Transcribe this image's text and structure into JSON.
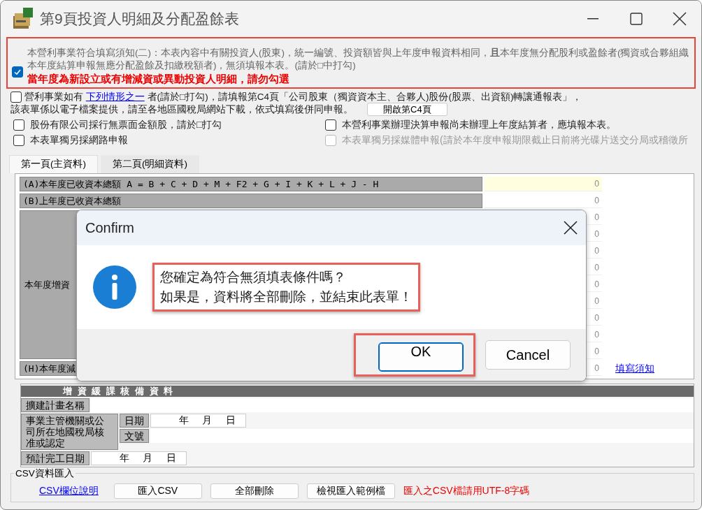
{
  "window": {
    "title": "第9頁投資人明細及分配盈餘表"
  },
  "notice": {
    "checked": true,
    "text": "本營利事業符合填寫須知(二)：本表內容中有關投資人(股東)，統一編號、投資額皆與上年度申報資料相同，**且**本年度無分配股利或盈餘者(獨資或合夥組織本年度結算申報無應分配盈餘及扣繳稅額者)，無須填報本表。(請於□中打勾)",
    "warning": "當年度為新設立或有增減資或異動投資人明細，請勿勾選"
  },
  "c4_notice": {
    "checked": false,
    "text_before": "營利事業如有",
    "link": "下列情形之一",
    "text_after": "者(請於□打勾)，請填報第C4頁「公司股東（獨資資本主、合夥人)股份(股票、出資額)轉讓通報表」，",
    "line2": "該表單係以電子檔案提供，請至各地區國稅局網站下載，依式填寫後併同申報。",
    "button": "開啟第C4頁"
  },
  "checkboxes": [
    {
      "label": "股份有限公司採行無票面金額股，請於□打勾",
      "checked": false,
      "disabled": false
    },
    {
      "label": "本營利事業辦理決算申報尚未辦理上年度結算者，應填報本表。",
      "checked": false,
      "disabled": false
    },
    {
      "label": "本表單獨另採網路申報",
      "checked": false,
      "disabled": false
    },
    {
      "label": "本表單獨另採媒體申報(請於本年度申報期限截止日前將光碟片送交分局或稽徵所",
      "checked": false,
      "disabled": true
    }
  ],
  "tabs": [
    {
      "label": "第一頁(主資料)",
      "selected": true
    },
    {
      "label": "第二頁(明細資料)",
      "selected": false
    }
  ],
  "table": {
    "rows": [
      {
        "kind": "single",
        "label": "(A)本年度已收資本總額 A = B + C + D + M + F2 +  G + I + K + L + J - H",
        "value": "0",
        "highlighted": true
      },
      {
        "kind": "single",
        "label": "(B)上年度已收資本總額",
        "value": "0",
        "highlighted": false
      },
      {
        "kind": "group",
        "label": "本年度增資",
        "values": [
          "0",
          "0",
          "0",
          "0",
          "0",
          "0",
          "0",
          "0",
          "0"
        ]
      },
      {
        "kind": "single",
        "label": "(H)本年度減",
        "value": "0",
        "highlighted": false
      }
    ],
    "link": "填寫須知"
  },
  "deferral": {
    "header": "增 資 緩 課 核 備 資 料",
    "plan_label": "擴建計畫名稱",
    "authority_label": "事業主管機關或公司所在地國稅局核准或認定",
    "date_label": "日期",
    "doc_label": "文號",
    "date_parts": [
      "年",
      "月",
      "日"
    ],
    "completion_label": "預計完工日期",
    "completion_parts": [
      "年",
      "月",
      "日"
    ]
  },
  "csv": {
    "legend": "CSV資料匯入",
    "link": "CSV欄位說明",
    "buttons": [
      "匯入CSV",
      "全部刪除",
      "檢視匯入範例檔"
    ],
    "note": "匯入之CSV檔請用UTF-8字碼"
  },
  "dialog": {
    "title": "Confirm",
    "message": [
      "您確定為符合無須填表條件嗎？",
      "如果是，資料將全部刪除，並結束此表單！"
    ],
    "buttons": [
      {
        "label": "OK",
        "default": true
      },
      {
        "label": "Cancel",
        "default": false
      }
    ]
  }
}
